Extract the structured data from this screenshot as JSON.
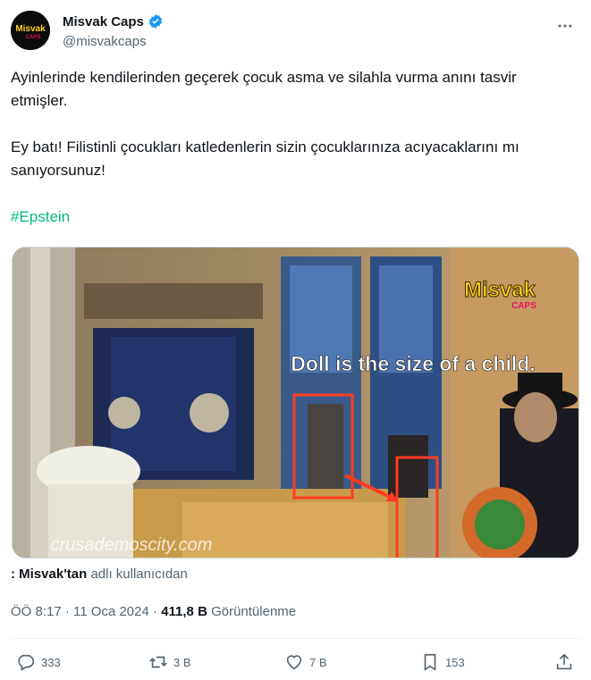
{
  "author": {
    "display_name": "Misvak Caps",
    "handle": "@misvakcaps",
    "avatar_text": "Misvak",
    "avatar_subtext": "CAPS"
  },
  "tweet": {
    "paragraph1": "Ayinlerinde kendilerinden geçerek çocuk asma ve silahla vurma anını tasvir etmişler.",
    "paragraph2": "Ey batı! Filistinli çocukları katledenlerin sizin çocuklarınıza acıyacaklarını mı sanıyorsunuz!",
    "hashtag": "#Epstein"
  },
  "media": {
    "caption": "Doll is the size of a child.",
    "watermark_main": "Misvak",
    "watermark_sub": "CAPS",
    "site_watermark": "crusademoscity.com"
  },
  "source": {
    "prefix": ": Misvak'tan",
    "suffix": "adlı kullanıcıdan"
  },
  "meta": {
    "time": "ÖÖ 8:17",
    "separator": "·",
    "date": "11 Oca 2024",
    "views_count": "411,8 B",
    "views_label": "Görüntülenme"
  },
  "actions": {
    "replies": "333",
    "retweets": "3 B",
    "likes": "7 B",
    "bookmarks": "153"
  },
  "colors": {
    "accent": "#1d9bf0",
    "hashtag": "#00ba7c",
    "text": "#0f1419",
    "secondary": "#536471",
    "highlight_box": "#ff3b1f"
  }
}
